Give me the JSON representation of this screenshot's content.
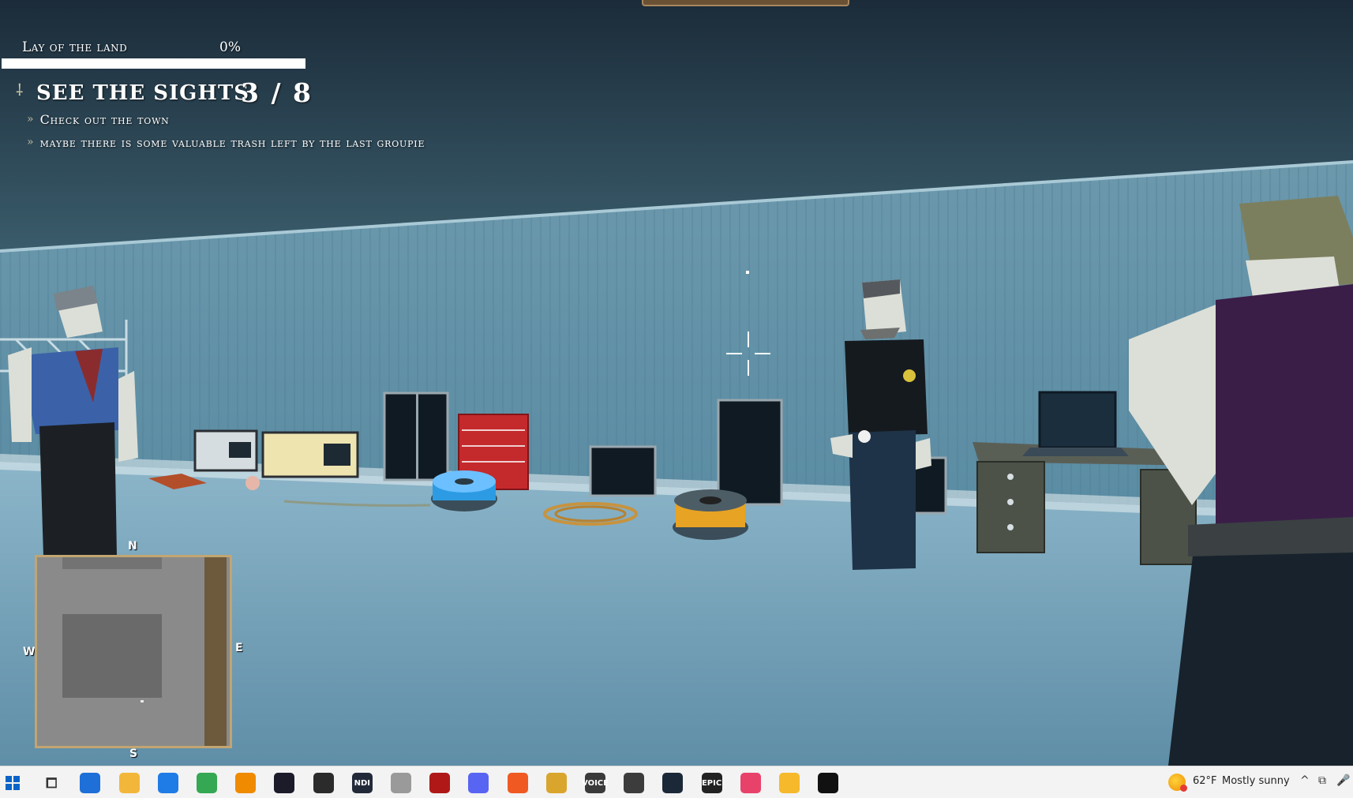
{
  "hud": {
    "area_name": "Lay of the land",
    "area_progress_label": "0%",
    "area_progress": 0,
    "quest_title": "SEE THE SIGHTS",
    "quest_count": "3 / 8",
    "objectives": [
      "Check out the town",
      "maybe there is some valuable trash left by the last groupie"
    ]
  },
  "minimap": {
    "north": "N",
    "south": "S",
    "west": "W",
    "east": "E"
  },
  "taskbar": {
    "apps": [
      {
        "icon": "start-icon",
        "color": "#0a64c8"
      },
      {
        "icon": "task-view-icon",
        "color": "#333333"
      },
      {
        "icon": "store-icon",
        "color": "#1e6fd8"
      },
      {
        "icon": "file-explorer-icon",
        "color": "#f2b73a"
      },
      {
        "icon": "mail-icon",
        "color": "#1f7be6"
      },
      {
        "icon": "chrome-icon",
        "color": "#34a853"
      },
      {
        "icon": "vlc-icon",
        "color": "#f08a00"
      },
      {
        "icon": "dev-app-icon",
        "color": "#1b1b2a"
      },
      {
        "icon": "obs-icon",
        "color": "#2b2b2b"
      },
      {
        "icon": "ndi-icon",
        "color": "#222a3a",
        "text": "NDI"
      },
      {
        "icon": "capture-app-icon",
        "color": "#9a9a9a"
      },
      {
        "icon": "m-app-icon",
        "color": "#b01818"
      },
      {
        "icon": "discord-icon",
        "color": "#5865f2"
      },
      {
        "icon": "media-player-icon",
        "color": "#f05a22"
      },
      {
        "icon": "edit-tool-icon",
        "color": "#d9a52d"
      },
      {
        "icon": "voicemeeter-icon",
        "color": "#3a3a3a",
        "text": "VOICE"
      },
      {
        "icon": "audio-app-icon",
        "color": "#3c3c3c"
      },
      {
        "icon": "steam-icon",
        "color": "#1b2838"
      },
      {
        "icon": "epic-games-icon",
        "color": "#222222",
        "text": "EPIC"
      },
      {
        "icon": "creative-cloud-icon",
        "color": "#e8426b"
      },
      {
        "icon": "video-app-icon",
        "color": "#f6b92c"
      },
      {
        "icon": "unreal-engine-icon",
        "color": "#111111"
      }
    ],
    "weather_temp": "62°F",
    "weather_desc": "Mostly sunny",
    "tray_chevron": "^"
  }
}
